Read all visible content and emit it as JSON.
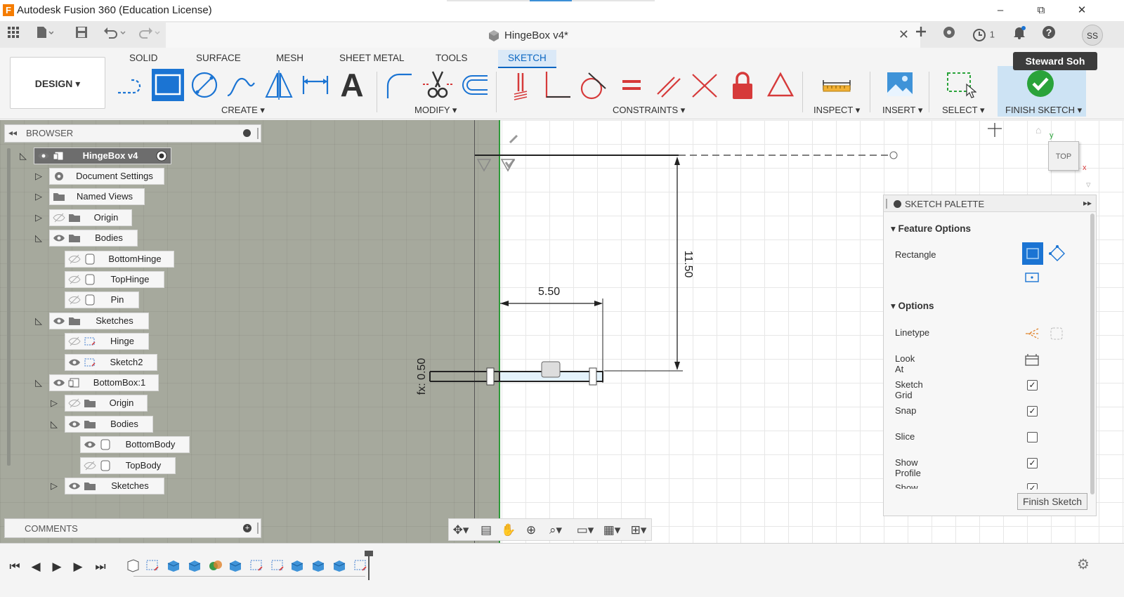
{
  "app": {
    "window_title": "Autodesk Fusion 360 (Education License)",
    "logo_letter": "F",
    "window_controls": [
      "–",
      "⧉",
      "✕"
    ]
  },
  "document": {
    "tab_title": "HingeBox v4*",
    "notification_count": "1",
    "user_initials": "SS",
    "user_name": "Steward Soh"
  },
  "toolbar": {
    "tabs": [
      "SOLID",
      "SURFACE",
      "MESH",
      "SHEET METAL",
      "TOOLS",
      "SKETCH"
    ],
    "active_tab": "SKETCH",
    "workspace": "DESIGN ▾",
    "groups": {
      "create": "CREATE ▾",
      "modify": "MODIFY ▾",
      "constraints": "CONSTRAINTS ▾",
      "inspect": "INSPECT ▾",
      "insert": "INSERT ▾",
      "select": "SELECT ▾",
      "finish": "FINISH SKETCH ▾"
    },
    "text_tool_glyph": "A",
    "accent_color": "#0a66c2"
  },
  "browser": {
    "title": "BROWSER",
    "nodes": [
      {
        "label": "HingeBox v4",
        "icon": "component-icon"
      },
      {
        "label": "Document Settings",
        "icon": "gear-icon"
      },
      {
        "label": "Named Views",
        "icon": "folder-icon"
      },
      {
        "label": "Origin",
        "icon": "folder-icon"
      },
      {
        "label": "Bodies",
        "icon": "folder-icon"
      },
      {
        "label": "BottomHinge",
        "icon": "body-icon"
      },
      {
        "label": "TopHinge",
        "icon": "body-icon"
      },
      {
        "label": "Pin",
        "icon": "body-icon"
      },
      {
        "label": "Sketches",
        "icon": "folder-icon"
      },
      {
        "label": "Hinge",
        "icon": "sketch-icon"
      },
      {
        "label": "Sketch2",
        "icon": "sketch-icon"
      },
      {
        "label": "BottomBox:1",
        "icon": "component-icon"
      },
      {
        "label": "Origin",
        "icon": "folder-icon"
      },
      {
        "label": "Bodies",
        "icon": "folder-icon"
      },
      {
        "label": "BottomBody",
        "icon": "body-icon"
      },
      {
        "label": "TopBody",
        "icon": "body-icon"
      },
      {
        "label": "Sketches",
        "icon": "folder-icon"
      }
    ]
  },
  "comments": {
    "title": "COMMENTS"
  },
  "canvas": {
    "dim_width": "5.50",
    "dim_height": "11.50",
    "dim_thickness": "fx: 0.50",
    "viewcube_label": "TOP"
  },
  "palette": {
    "title": "SKETCH PALETTE",
    "feature_options": "Feature Options",
    "rectangle_label": "Rectangle",
    "options": "Options",
    "rows": [
      {
        "label": "Linetype",
        "type": "icon"
      },
      {
        "label": "Look At",
        "type": "icon"
      },
      {
        "label": "Sketch Grid",
        "type": "check",
        "checked": true
      },
      {
        "label": "Snap",
        "type": "check",
        "checked": true
      },
      {
        "label": "Slice",
        "type": "check",
        "checked": false
      },
      {
        "label": "Show Profile",
        "type": "check",
        "checked": true
      },
      {
        "label": "Show Points",
        "type": "check",
        "checked": true
      }
    ],
    "finish_button": "Finish Sketch",
    "check_glyph": "✓"
  }
}
